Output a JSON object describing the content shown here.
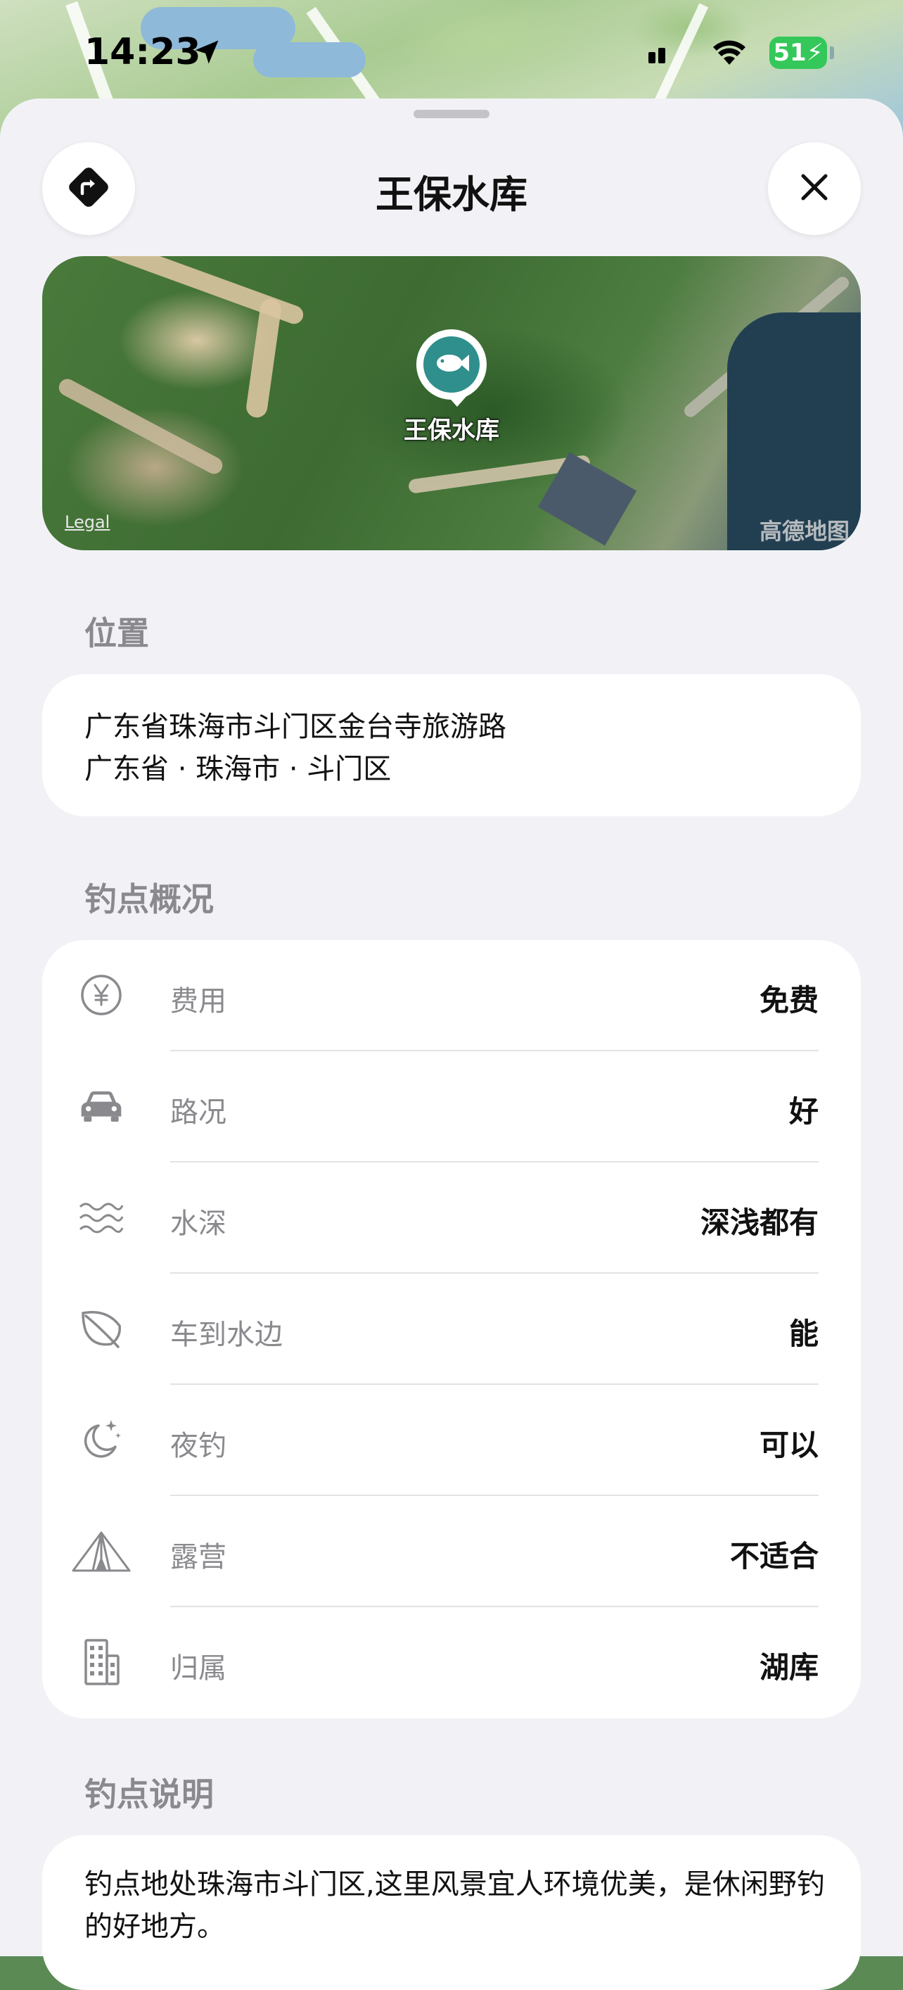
{
  "status_bar": {
    "time": "14:23",
    "battery": "51"
  },
  "header": {
    "title": "王保水库"
  },
  "map_preview": {
    "pin_label": "王保水库",
    "legal": "Legal",
    "provider": "高德地图"
  },
  "location": {
    "section_title": "位置",
    "address": "广东省珠海市斗门区金台寺旅游路",
    "region": "广东省 · 珠海市 · 斗门区"
  },
  "overview": {
    "section_title": "钓点概况",
    "rows": [
      {
        "icon": "yen-icon",
        "label": "费用",
        "value": "免费"
      },
      {
        "icon": "car-icon",
        "label": "路况",
        "value": "好"
      },
      {
        "icon": "water-waves-icon",
        "label": "水深",
        "value": "深浅都有"
      },
      {
        "icon": "leaf-icon",
        "label": "车到水边",
        "value": "能"
      },
      {
        "icon": "moon-stars-icon",
        "label": "夜钓",
        "value": "可以"
      },
      {
        "icon": "tent-icon",
        "label": "露营",
        "value": "不适合"
      },
      {
        "icon": "building-icon",
        "label": "归属",
        "value": "湖库"
      }
    ]
  },
  "description": {
    "section_title": "钓点说明",
    "text": "钓点地处珠海市斗门区,这里风景宜人环境优美，是休闲野钓的好地方。"
  }
}
